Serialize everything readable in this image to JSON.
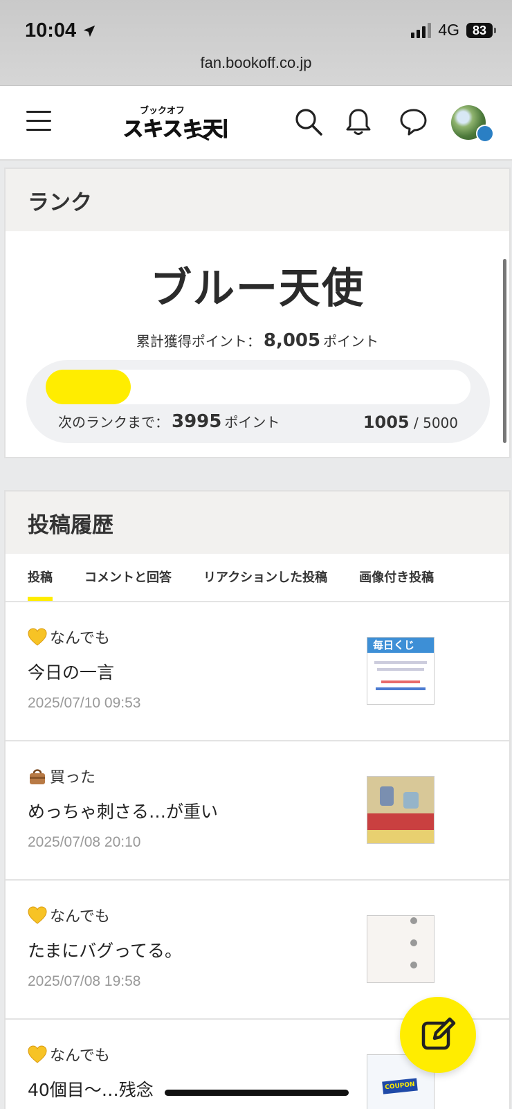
{
  "status_bar": {
    "time": "10:04",
    "network": "4G",
    "battery": "83"
  },
  "browser": {
    "url": "fan.bookoff.co.jp"
  },
  "header": {
    "logo_text": "スキスキ天国",
    "logo_sub": "ブックオフ"
  },
  "rank": {
    "title": "ランク",
    "name": "ブルー天使",
    "total_label": "累計獲得ポイント：",
    "total_value": "8,005",
    "points_unit": "ポイント",
    "next_label": "次のランクまで：",
    "next_value": "3995",
    "current": "1005",
    "separator": "/",
    "goal": "5000",
    "progress_fraction": 0.201
  },
  "history": {
    "title": "投稿履歴",
    "tabs": [
      "投稿",
      "コメントと回答",
      "リアクションした投稿",
      "画像付き投稿"
    ],
    "posts": [
      {
        "category_icon": "yellow-heart-icon",
        "category": "なんでも",
        "title": "今日の一言",
        "date": "2025/07/10 09:53"
      },
      {
        "category_icon": "handbag-icon",
        "category": "買った",
        "title": "めっちゃ刺さる…が重い",
        "date": "2025/07/08 20:10"
      },
      {
        "category_icon": "yellow-heart-icon",
        "category": "なんでも",
        "title": "たまにバグってる。",
        "date": "2025/07/08 19:58"
      },
      {
        "category_icon": "yellow-heart-icon",
        "category": "なんでも",
        "title": "40個目〜…残念",
        "date": ""
      }
    ]
  },
  "thumbs": {
    "t1_title": "毎日くじ",
    "t4_badge": "COUPON"
  },
  "colors": {
    "accent": "#ffed00",
    "card_head": "#f2f1ef",
    "date_gray": "#999999"
  }
}
